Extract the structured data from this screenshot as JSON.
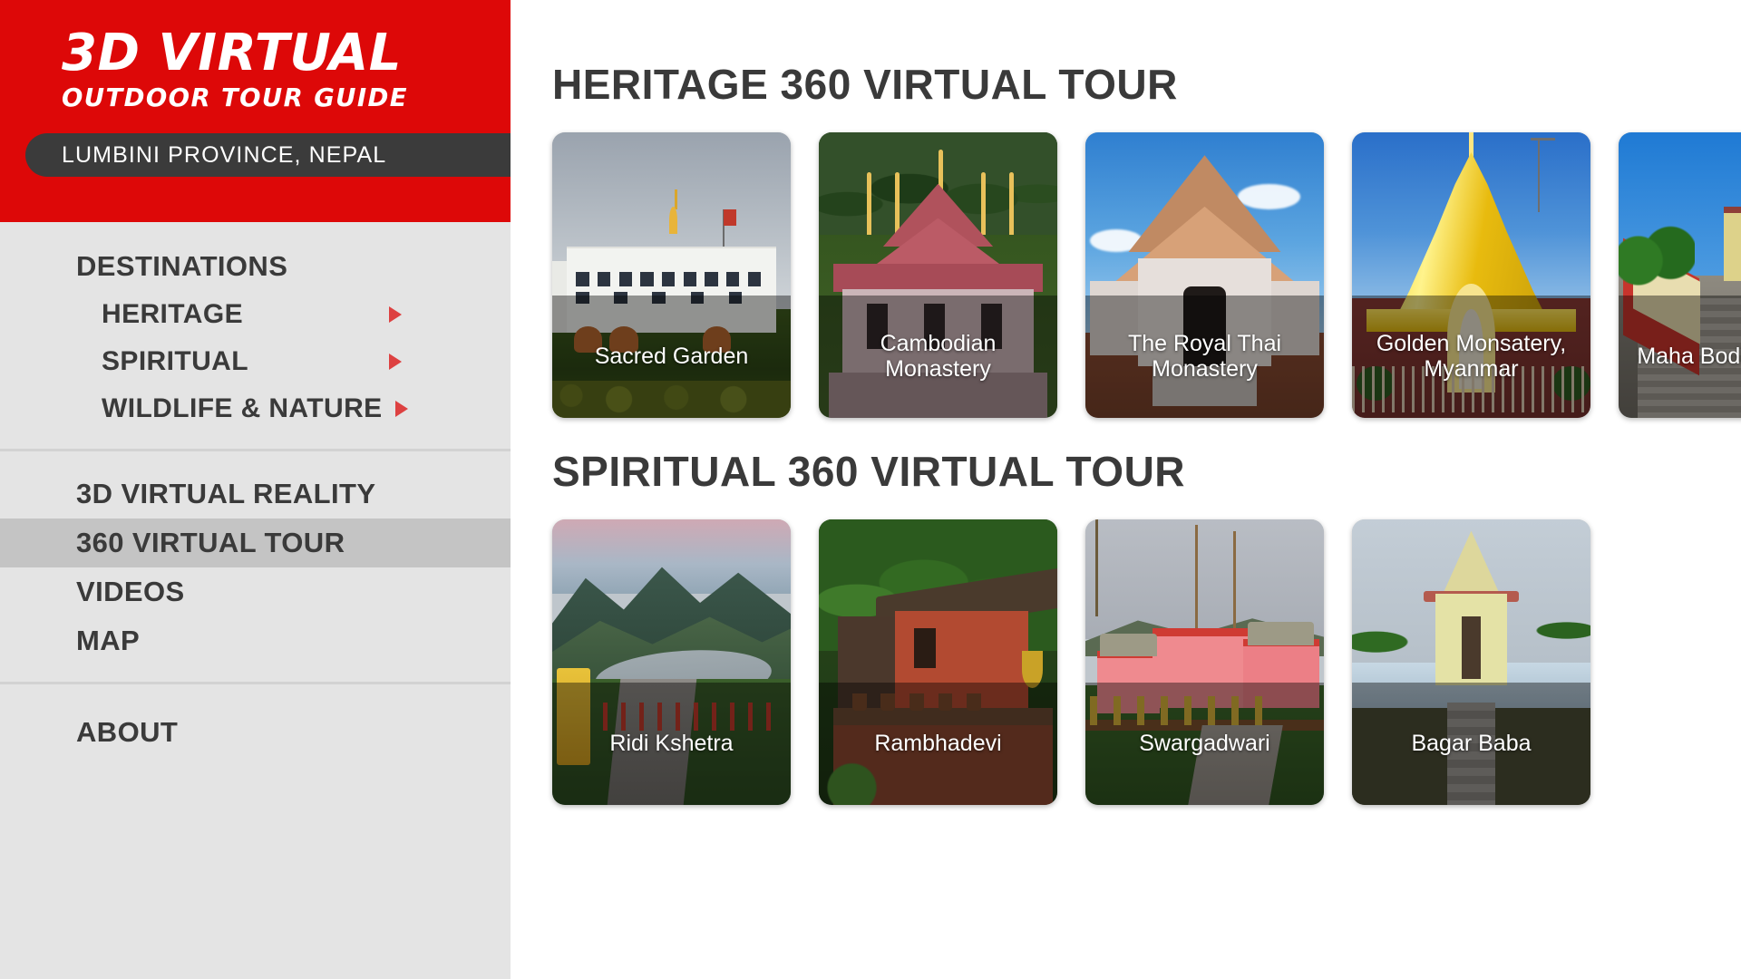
{
  "brand": {
    "title_line1": "3D VIRTUAL",
    "title_line2": "OUTDOOR TOUR GUIDE",
    "location_chip": "LUMBINI PROVINCE, NEPAL",
    "accent_color": "#dd0808",
    "chip_color": "#3b3b3b"
  },
  "sidebar": {
    "groups": [
      {
        "items": [
          {
            "label": "DESTINATIONS",
            "type": "heading",
            "arrow": false,
            "active": false
          },
          {
            "label": "HERITAGE",
            "type": "sub",
            "arrow": true,
            "active": false
          },
          {
            "label": "SPIRITUAL",
            "type": "sub",
            "arrow": true,
            "active": false
          },
          {
            "label": "WILDLIFE & NATURE",
            "type": "sub",
            "arrow": true,
            "active": false
          }
        ]
      },
      {
        "items": [
          {
            "label": "3D VIRTUAL REALITY",
            "type": "heading",
            "arrow": false,
            "active": false
          },
          {
            "label": "360 VIRTUAL TOUR",
            "type": "heading",
            "arrow": false,
            "active": true
          },
          {
            "label": "VIDEOS",
            "type": "heading",
            "arrow": false,
            "active": false
          },
          {
            "label": "MAP",
            "type": "heading",
            "arrow": false,
            "active": false
          }
        ]
      },
      {
        "items": [
          {
            "label": "ABOUT",
            "type": "heading",
            "arrow": false,
            "active": false
          }
        ]
      }
    ],
    "arrow_color": "#dd4141",
    "active_bg": "#c4c4c4",
    "background": "#e4e4e4"
  },
  "main": {
    "sections": [
      {
        "title": "HERITAGE 360 VIRTUAL TOUR",
        "cards": [
          {
            "title": "Sacred Garden",
            "scene": "sg"
          },
          {
            "title": "Cambodian Monastery",
            "scene": "cb"
          },
          {
            "title": "The Royal Thai Monastery",
            "scene": "rt"
          },
          {
            "title": "Golden Monsatery, Myanmar",
            "scene": "gm"
          },
          {
            "title": "Maha Bodhi Society",
            "scene": "mb"
          }
        ]
      },
      {
        "title": "SPIRITUAL 360 VIRTUAL TOUR",
        "cards": [
          {
            "title": "Ridi Kshetra",
            "scene": "rk"
          },
          {
            "title": "Rambhadevi",
            "scene": "rb"
          },
          {
            "title": "Swargadwari",
            "scene": "sw"
          },
          {
            "title": "Bagar Baba",
            "scene": "bb"
          }
        ]
      }
    ]
  }
}
